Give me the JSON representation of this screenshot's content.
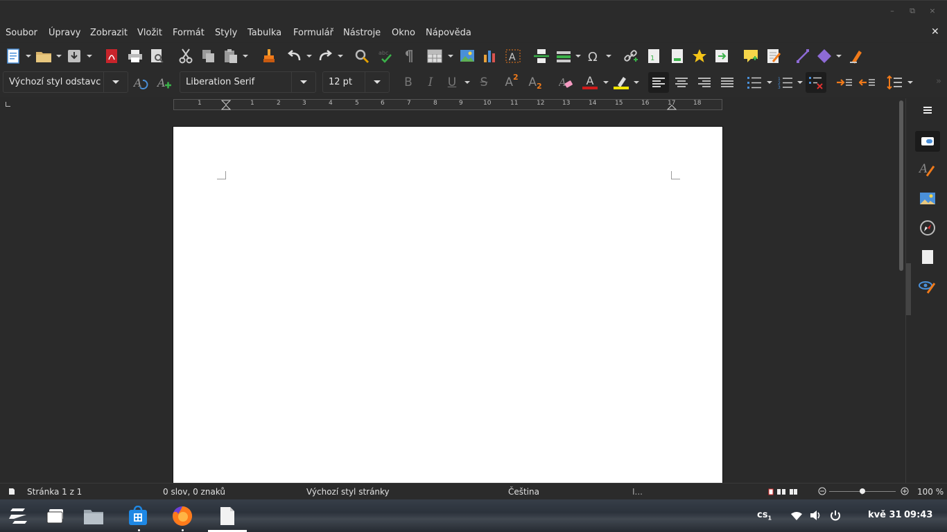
{
  "window": {
    "minimize_glyph": "–",
    "restore_glyph": "⧉",
    "close_glyph": "×"
  },
  "menu": {
    "items": [
      "Soubor",
      "Úpravy",
      "Zobrazit",
      "Vložit",
      "Formát",
      "Styly",
      "Tabulka",
      "Formulář",
      "Nástroje",
      "Okno",
      "Nápověda"
    ],
    "close_glyph": "✕"
  },
  "formatting": {
    "paragraph_style": "Výchozí styl odstavc",
    "font_name": "Liberation Serif",
    "font_size": "12 pt",
    "bold_glyph": "B",
    "italic_glyph": "I",
    "underline_glyph": "U",
    "strike_glyph": "S",
    "superscript_glyph": "A",
    "subscript_glyph": "A",
    "sup_digit": "2",
    "sub_digit": "2",
    "font_color_glyph": "A",
    "highlight_color": "#f2e600",
    "font_color": "#d01c1c"
  },
  "ruler": {
    "numbers": [
      "1",
      "1",
      "2",
      "3",
      "4",
      "5",
      "6",
      "7",
      "8",
      "9",
      "10",
      "11",
      "12",
      "13",
      "14",
      "15",
      "16",
      "17",
      "18"
    ]
  },
  "status": {
    "page": "Stránka 1 z 1",
    "words": "0 slov, 0 znaků",
    "page_style": "Výchozí styl stránky",
    "language": "Čeština",
    "selection_mode": "I...",
    "zoom": "100 %",
    "zoom_level": 0.5
  },
  "tray": {
    "keyboard": "cs",
    "keyboard_sub": "1",
    "date": "kvě 31",
    "time": "09:43"
  },
  "colors": {
    "accent": "#4a90d9",
    "orange": "#f07a1a",
    "purple": "#8e6bd6"
  }
}
